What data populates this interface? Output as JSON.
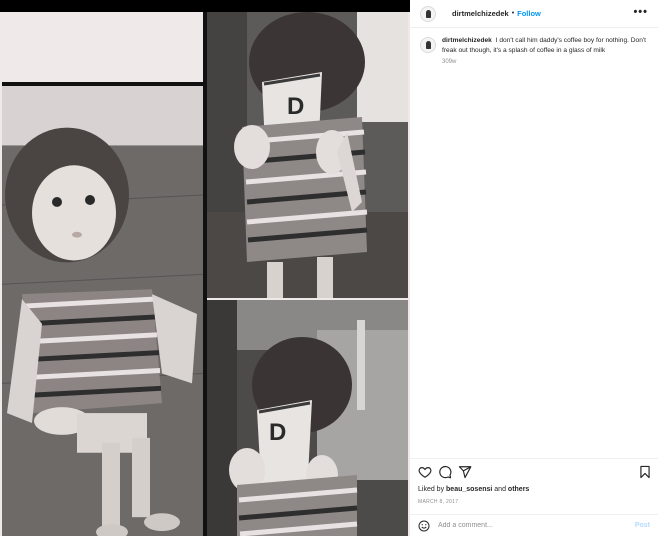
{
  "post": {
    "username": "dirtmelchizedek",
    "follow_label": "Follow",
    "separator": "•",
    "more_label": "•••"
  },
  "caption": {
    "username": "dirtmelchizedek",
    "text": "I don't call him daddy's coffee boy for nothing. Don't freak out though, it's a splash of coffee in a glass of milk",
    "time_ago": "309w"
  },
  "media": {
    "mug_letter": "D"
  },
  "actions": {
    "icons": [
      "heart-icon",
      "comment-bubble-icon",
      "paper-plane-icon",
      "bookmark-icon"
    ]
  },
  "likes": {
    "prefix": "Liked by ",
    "user": "beau_sosensi",
    "middle": " and ",
    "others": "others"
  },
  "date": "MARCH 8, 2017",
  "comment_box": {
    "placeholder": "Add a comment...",
    "post_label": "Post"
  },
  "colors": {
    "accent": "#0095f6",
    "post_disabled": "#b3dbff",
    "muted": "#8e8e8e"
  }
}
